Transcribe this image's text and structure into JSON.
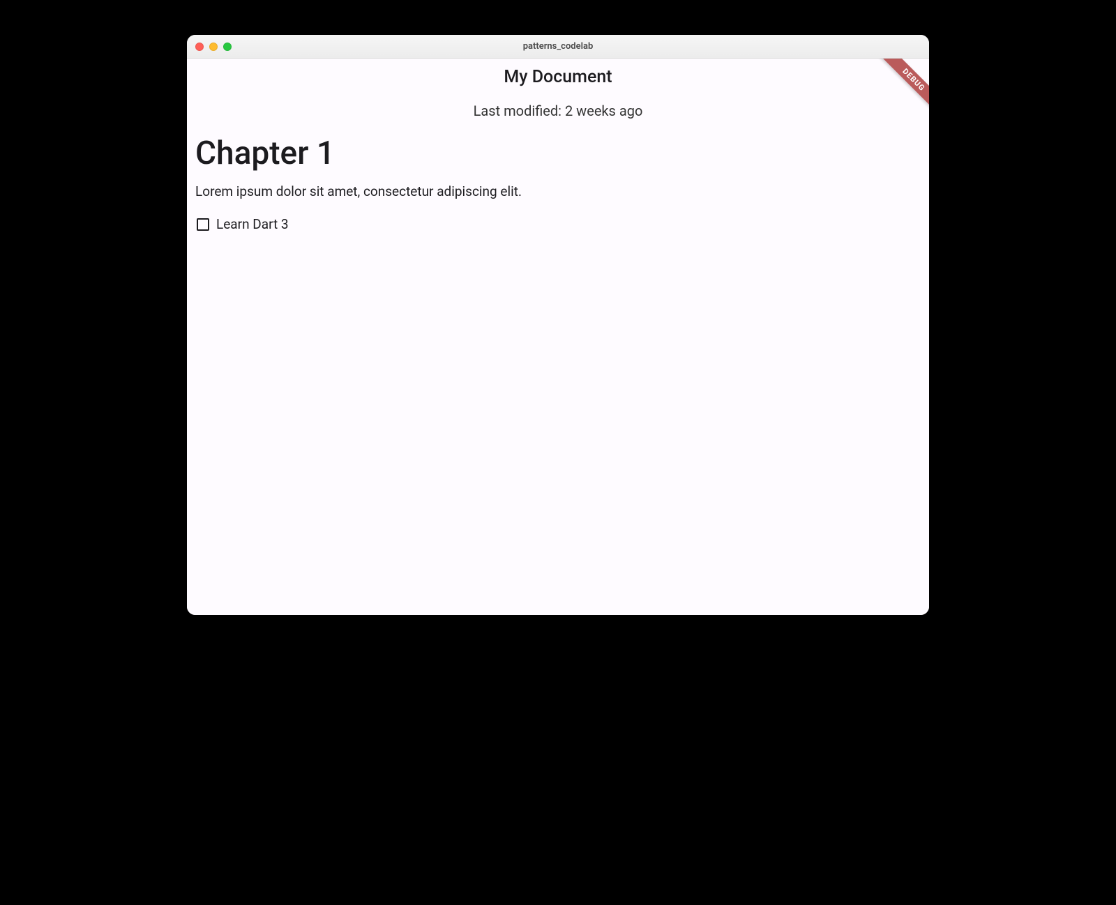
{
  "window": {
    "title": "patterns_codelab"
  },
  "debug_banner": "DEBUG",
  "appbar": {
    "title": "My Document"
  },
  "meta": {
    "last_modified": "Last modified: 2 weeks ago"
  },
  "blocks": [
    {
      "type": "h1",
      "text": "Chapter 1"
    },
    {
      "type": "p",
      "text": "Lorem ipsum dolor sit amet, consectetur adipiscing elit."
    },
    {
      "type": "checkbox",
      "checked": false,
      "label": "Learn Dart 3"
    }
  ]
}
